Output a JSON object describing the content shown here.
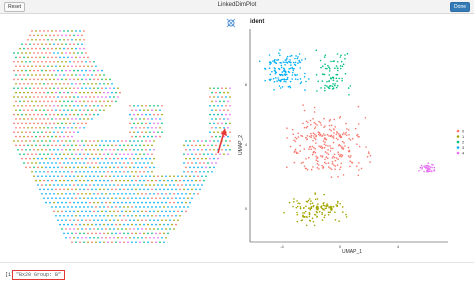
{
  "window": {
    "title": "LinkedDimPlot"
  },
  "toolbar": {
    "reset_label": "Reset",
    "done_label": "Done"
  },
  "left_plot": {
    "brush_icon": "lasso-tool-icon"
  },
  "right_plot": {
    "legend_title": "ident",
    "xlabel": "UMAP_1",
    "ylabel": "UMAP_2",
    "xticks": [
      "-4",
      "0",
      "4"
    ],
    "yticks": [
      "0",
      "4",
      "8"
    ],
    "legend": [
      {
        "label": "0",
        "color": "#F8766D"
      },
      {
        "label": "1",
        "color": "#A3A500"
      },
      {
        "label": "2",
        "color": "#00BF7D"
      },
      {
        "label": "3",
        "color": "#00B0F6"
      },
      {
        "label": "4",
        "color": "#E76BF3"
      }
    ]
  },
  "console": {
    "prompt": "[1]",
    "output": "\"Bx20 Group: B\""
  }
}
